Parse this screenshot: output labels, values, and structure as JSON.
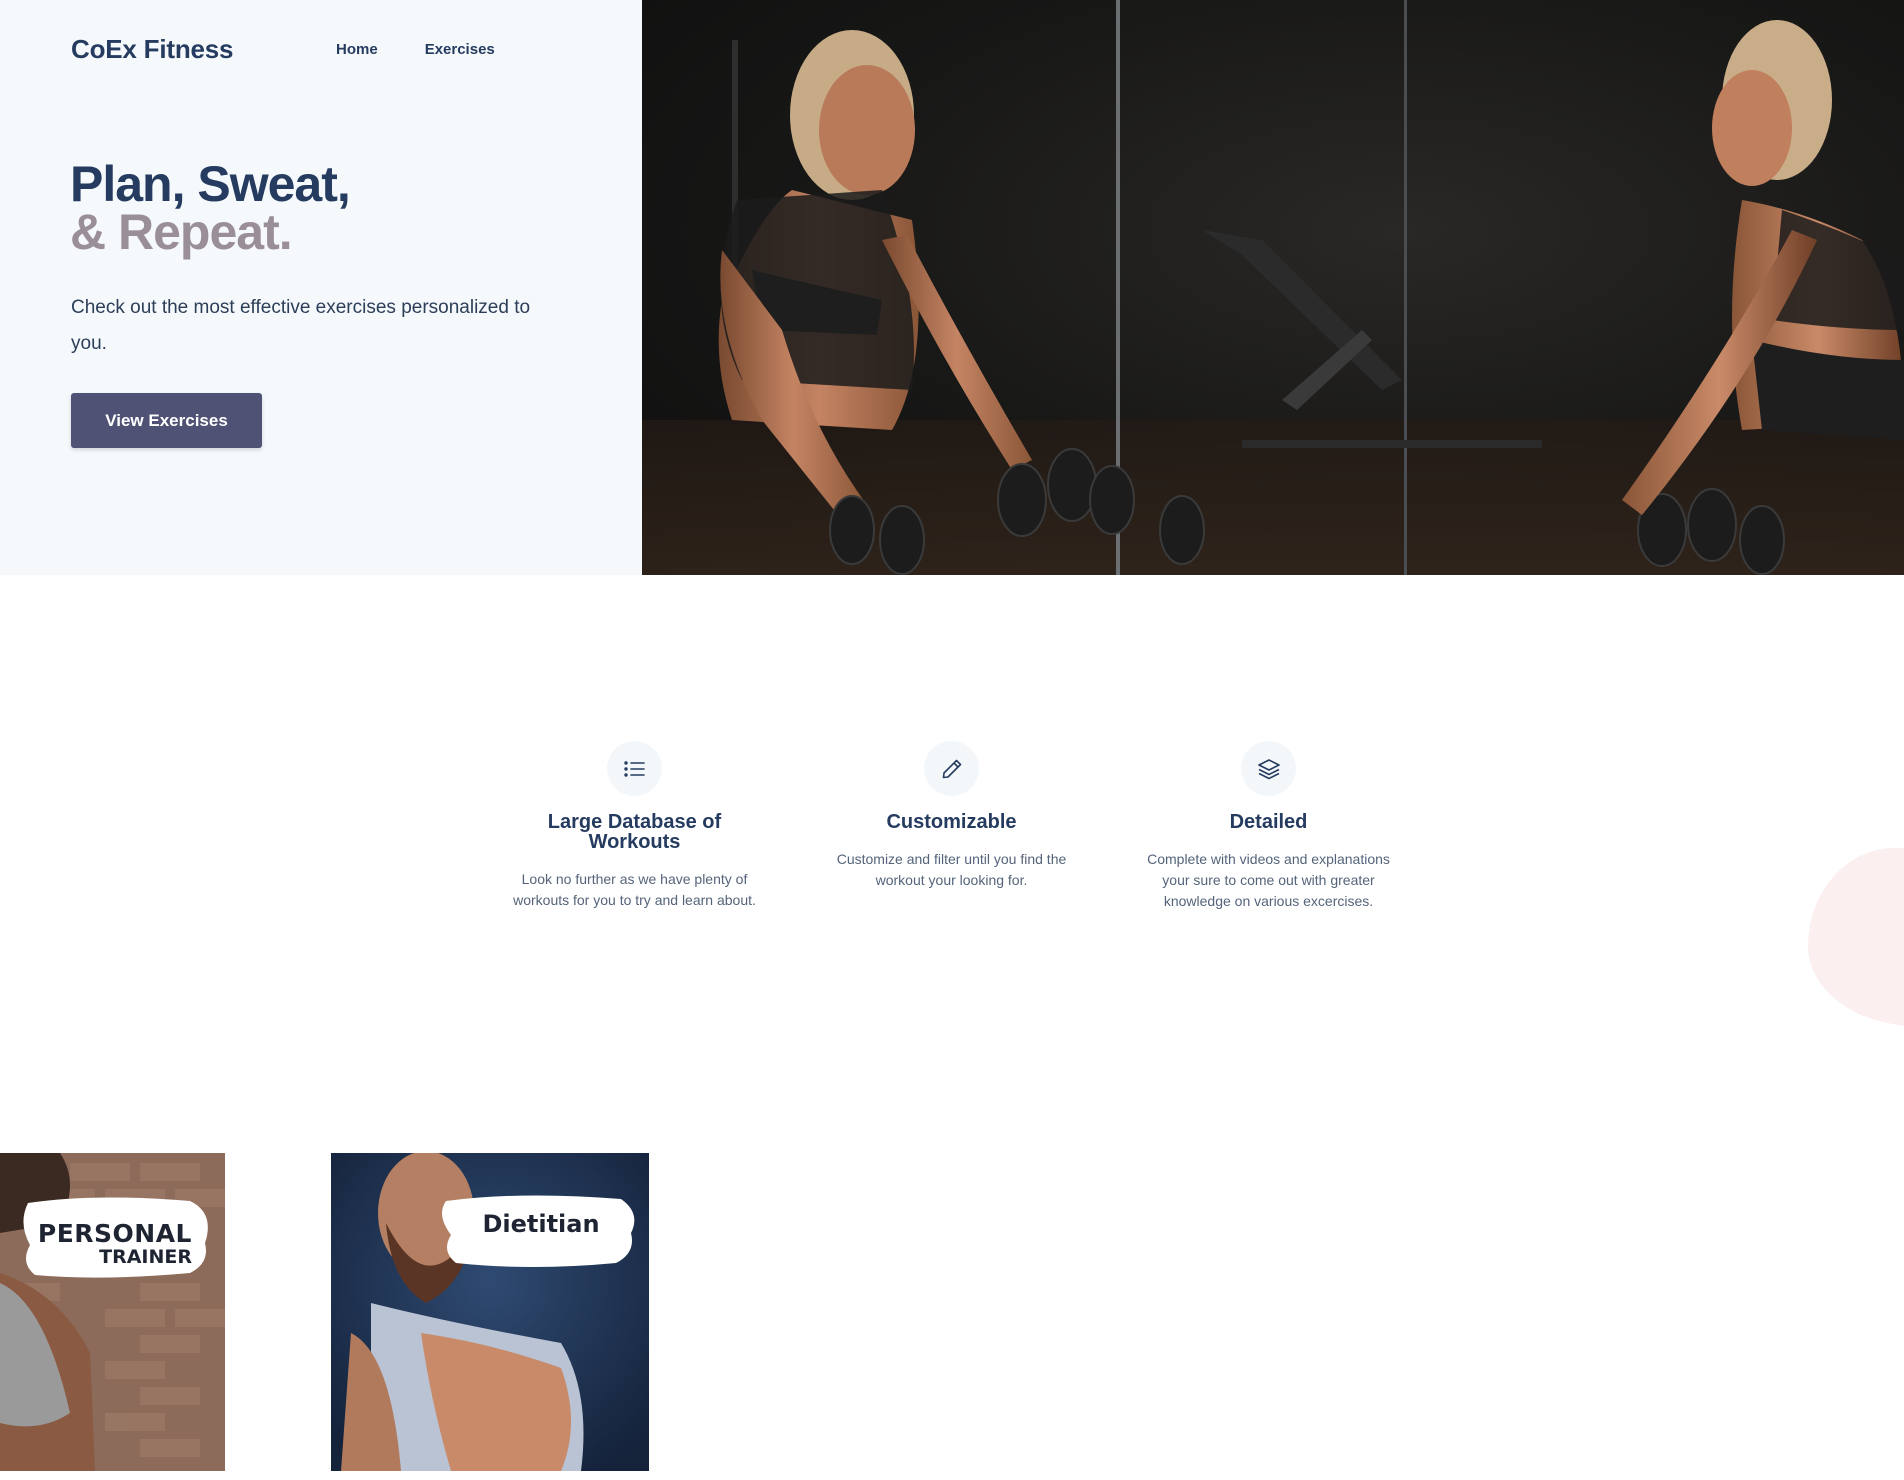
{
  "header": {
    "brand": "CoEx Fitness",
    "nav": [
      {
        "label": "Home"
      },
      {
        "label": "Exercises"
      }
    ]
  },
  "hero": {
    "headline_line1": "Plan, Sweat,",
    "headline_line2": "& Repeat.",
    "subtitle": "Check out the most effective exercises personalized to you.",
    "cta_label": "View Exercises"
  },
  "features": [
    {
      "icon": "list-icon",
      "title": "Large Database of Workouts",
      "text": "Look no further as we have plenty of workouts for you to try and learn about."
    },
    {
      "icon": "pencil-icon",
      "title": "Customizable",
      "text": "Customize and filter until you find the workout your looking for."
    },
    {
      "icon": "layers-icon",
      "title": "Detailed",
      "text": "Complete with videos and explanations your sure to come out with greater knowledge on various excercises."
    }
  ],
  "cards": [
    {
      "label_line1": "PERSONAL",
      "label_line2": "TRAINER"
    },
    {
      "label_line1": "Dietitian"
    }
  ],
  "colors": {
    "navy": "#253b5f",
    "mauve": "#9a8f98",
    "button": "#4f5274",
    "hero_bg": "#f5f9fc",
    "blob": "#fcefef"
  }
}
